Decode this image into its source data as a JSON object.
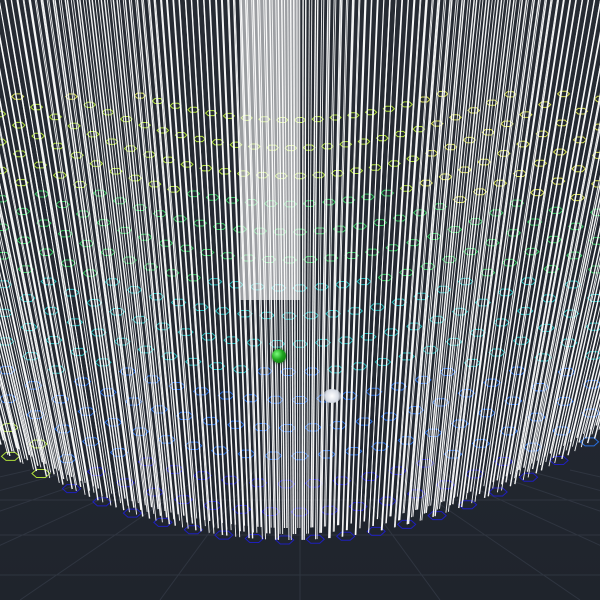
{
  "viewport": {
    "background_color": "#232831",
    "ground_grid_color": "#2f3540",
    "strand_color": "#ffffff",
    "dot_color": "#ffffff"
  },
  "scene": {
    "color_ramp": [
      "#1f1fd6",
      "#2a7bff",
      "#22d1d1",
      "#38e06a",
      "#c8ff3c",
      "#f7ff5a"
    ]
  },
  "gizmo": {
    "icon": "transform-gizmo-icon",
    "color": "#1ea51e"
  },
  "handle": {
    "icon": "move-handle-icon"
  }
}
